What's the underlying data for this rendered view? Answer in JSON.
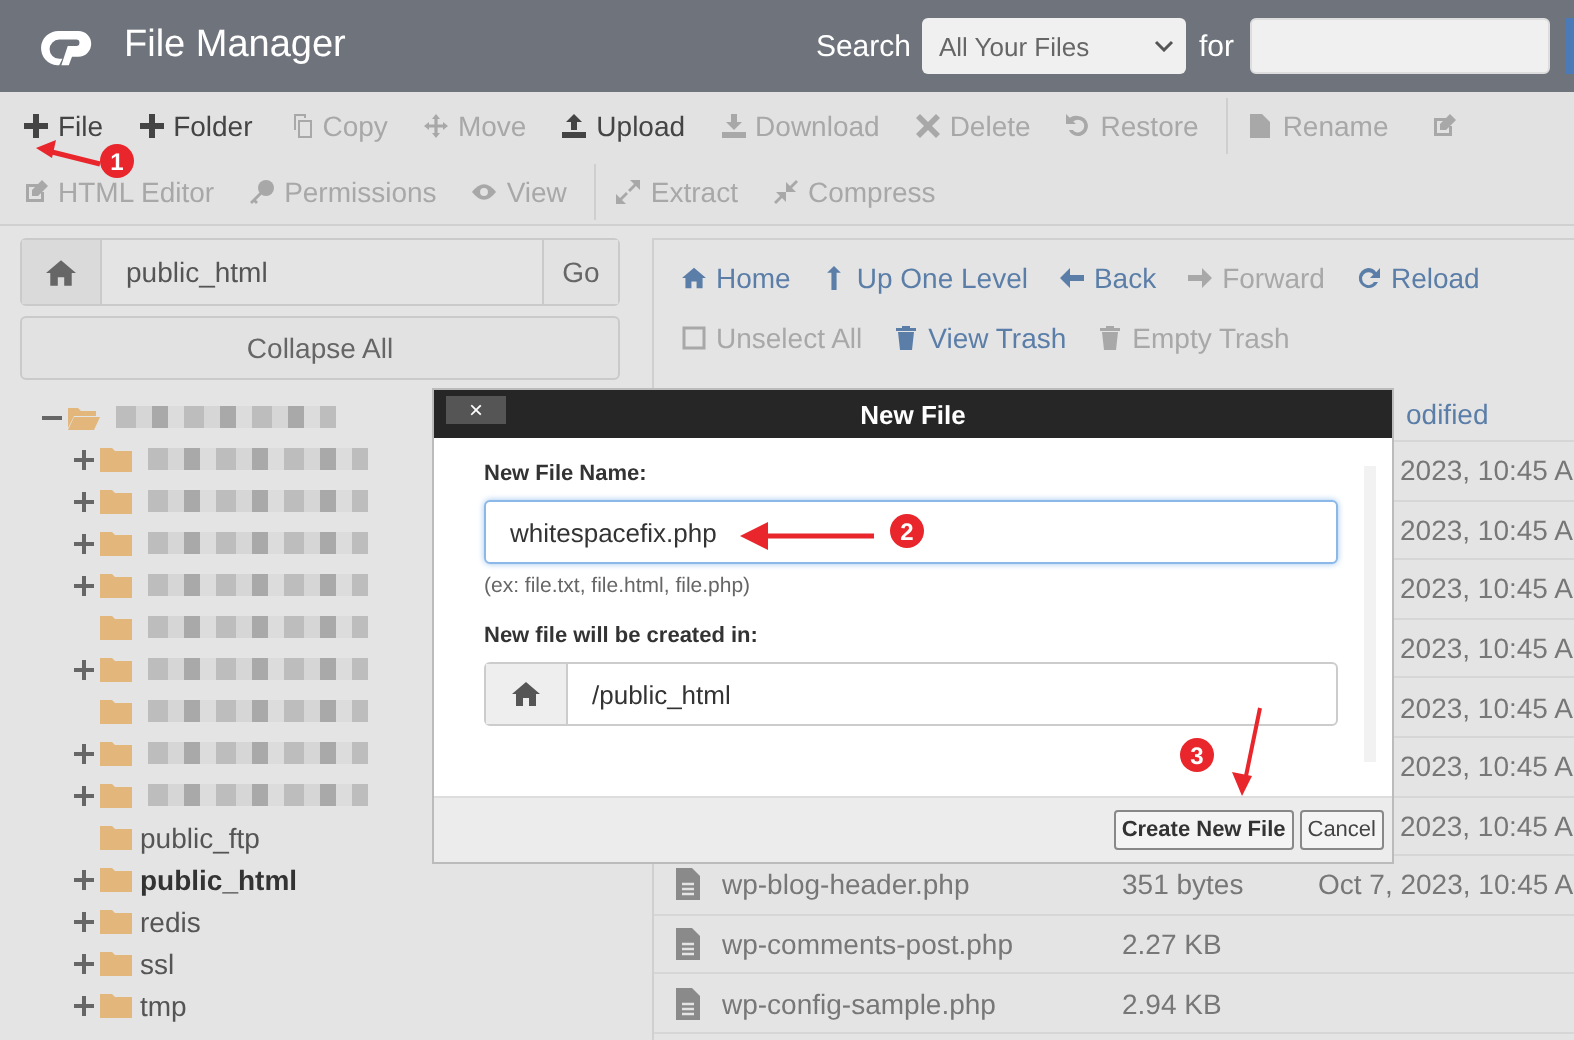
{
  "header": {
    "title": "File Manager",
    "search_label": "Search",
    "search_scope": "All Your Files",
    "for_label": "for"
  },
  "toolbar": [
    {
      "label": "File",
      "disabled": false
    },
    {
      "label": "Folder",
      "disabled": false
    },
    {
      "label": "Copy",
      "disabled": true
    },
    {
      "label": "Move",
      "disabled": true
    },
    {
      "label": "Upload",
      "disabled": false
    },
    {
      "label": "Download",
      "disabled": true
    },
    {
      "label": "Delete",
      "disabled": true
    },
    {
      "label": "Restore",
      "disabled": true
    },
    {
      "label": "Rename",
      "disabled": true
    }
  ],
  "toolbar_row2": [
    {
      "label": "HTML Editor",
      "disabled": true
    },
    {
      "label": "Permissions",
      "disabled": true
    },
    {
      "label": "View",
      "disabled": true
    },
    {
      "label": "Extract",
      "disabled": true
    },
    {
      "label": "Compress",
      "disabled": true
    }
  ],
  "sidebar": {
    "path": "public_html",
    "go": "Go",
    "collapse": "Collapse All",
    "tree": [
      {
        "kind": "redacted",
        "expanded": true,
        "expandable": true,
        "children": [
          {
            "kind": "redacted",
            "expanded": false,
            "expandable": true
          },
          {
            "kind": "redacted",
            "expanded": false,
            "expandable": true
          },
          {
            "kind": "redacted",
            "expanded": false,
            "expandable": true
          },
          {
            "kind": "redacted",
            "expanded": false,
            "expandable": true
          },
          {
            "kind": "redacted",
            "expandable": false
          },
          {
            "kind": "redacted",
            "expanded": false,
            "expandable": true
          },
          {
            "kind": "redacted",
            "expandable": false
          },
          {
            "kind": "redacted",
            "expanded": false,
            "expandable": true
          },
          {
            "kind": "redacted",
            "expanded": false,
            "expandable": true
          },
          {
            "kind": "folder",
            "label": "public_ftp",
            "expandable": false,
            "selected": false
          },
          {
            "kind": "folder",
            "label": "public_html",
            "expanded": false,
            "expandable": true,
            "selected": true
          },
          {
            "kind": "folder",
            "label": "redis",
            "expanded": false,
            "expandable": true,
            "selected": false
          },
          {
            "kind": "folder",
            "label": "ssl",
            "expanded": false,
            "expandable": true,
            "selected": false
          },
          {
            "kind": "folder",
            "label": "tmp",
            "expanded": false,
            "expandable": true,
            "selected": false
          }
        ]
      }
    ]
  },
  "nav": [
    {
      "label": "Home",
      "disabled": false
    },
    {
      "label": "Up One Level",
      "disabled": false
    },
    {
      "label": "Back",
      "disabled": false
    },
    {
      "label": "Forward",
      "disabled": true
    },
    {
      "label": "Reload",
      "disabled": false
    }
  ],
  "nav_row2": [
    {
      "label": "Unselect All",
      "disabled": true
    },
    {
      "label": "View Trash",
      "disabled": false
    },
    {
      "label": "Empty Trash",
      "disabled": true
    }
  ],
  "table": {
    "modified_header": "odified",
    "rows": [
      {
        "modified": "2023, 10:45 A"
      },
      {
        "modified": "2023, 10:45 A"
      },
      {
        "modified": "2023, 10:45 A"
      },
      {
        "modified": "2023, 10:45 A"
      },
      {
        "modified": "2023, 10:45 A"
      },
      {
        "modified": "2023, 10:45 A"
      },
      {
        "modified": "2023, 10:45 A"
      },
      {
        "name": "wp-blog-header.php",
        "size": "351 bytes",
        "modified": "Oct 7, 2023, 10:45 A"
      },
      {
        "name": "wp-comments-post.php",
        "size": "2.27 KB"
      },
      {
        "name": "wp-config-sample.php",
        "size": "2.94 KB"
      }
    ]
  },
  "dialog": {
    "close": "×",
    "title": "New File",
    "name_label": "New File Name:",
    "name_value": "whitespacefix.php",
    "hint": "(ex: file.txt, file.html, file.php)",
    "dir_label": "New file will be created in:",
    "dir_value": "/public_html",
    "buttons": [
      "Create New File",
      "Cancel"
    ]
  },
  "annotations": [
    {
      "label": "1"
    },
    {
      "label": "2"
    },
    {
      "label": "3"
    }
  ]
}
